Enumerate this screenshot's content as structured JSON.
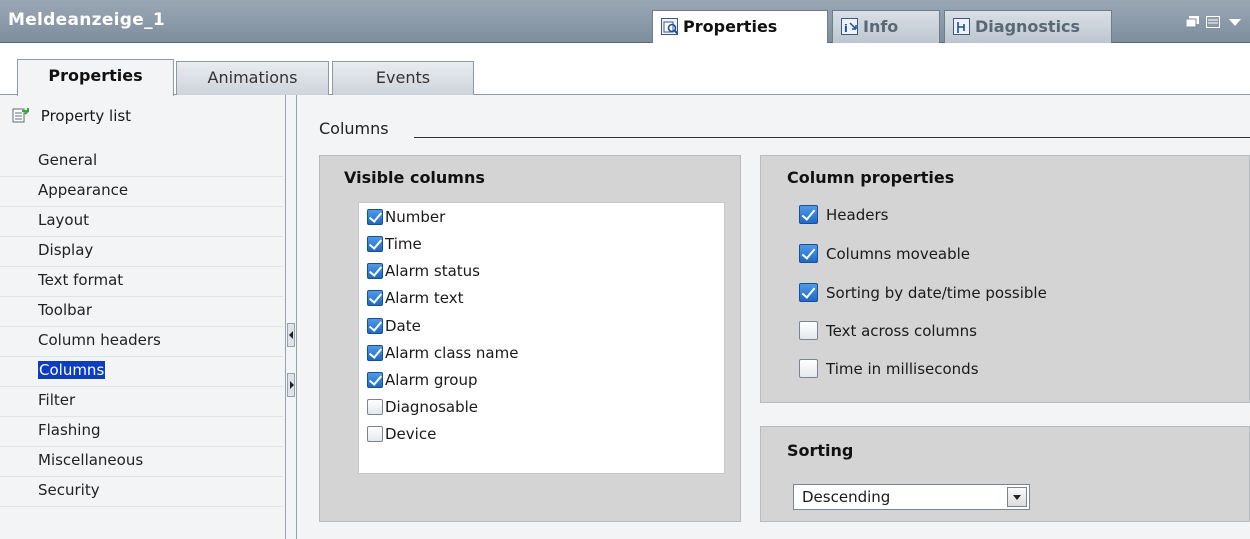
{
  "window": {
    "title": "Meldeanzeige_1",
    "top_tabs": [
      {
        "label": "Properties",
        "icon": "inspect-properties-icon",
        "active": true
      },
      {
        "label": "Info",
        "icon": "info-icon",
        "active": false
      },
      {
        "label": "Diagnostics",
        "icon": "diagnostics-icon",
        "active": false
      }
    ]
  },
  "subtabs": [
    {
      "label": "Properties",
      "active": true
    },
    {
      "label": "Animations",
      "active": false
    },
    {
      "label": "Events",
      "active": false
    }
  ],
  "nav": {
    "property_list_label": "Property list",
    "items": [
      "General",
      "Appearance",
      "Layout",
      "Display",
      "Text format",
      "Toolbar",
      "Column headers",
      "Columns",
      "Filter",
      "Flashing",
      "Miscellaneous",
      "Security"
    ],
    "selected": "Columns"
  },
  "content": {
    "section_title": "Columns",
    "visible_columns": {
      "title": "Visible columns",
      "items": [
        {
          "label": "Number",
          "checked": true
        },
        {
          "label": "Time",
          "checked": true
        },
        {
          "label": "Alarm status",
          "checked": true
        },
        {
          "label": "Alarm text",
          "checked": true
        },
        {
          "label": "Date",
          "checked": true
        },
        {
          "label": "Alarm class name",
          "checked": true
        },
        {
          "label": "Alarm group",
          "checked": true
        },
        {
          "label": "Diagnosable",
          "checked": false
        },
        {
          "label": "Device",
          "checked": false
        }
      ]
    },
    "column_properties": {
      "title": "Column properties",
      "items": [
        {
          "label": "Headers",
          "checked": true
        },
        {
          "label": "Columns moveable",
          "checked": true
        },
        {
          "label": "Sorting by date/time possible",
          "checked": true
        },
        {
          "label": "Text across columns",
          "checked": false
        },
        {
          "label": "Time in milliseconds",
          "checked": false
        }
      ]
    },
    "sorting": {
      "title": "Sorting",
      "value": "Descending"
    }
  },
  "colors": {
    "titlebar": "#8a98a7",
    "selection": "#0a3cc8",
    "checkbox_checked": "#1c69c9",
    "panel": "#d4d4d4"
  }
}
